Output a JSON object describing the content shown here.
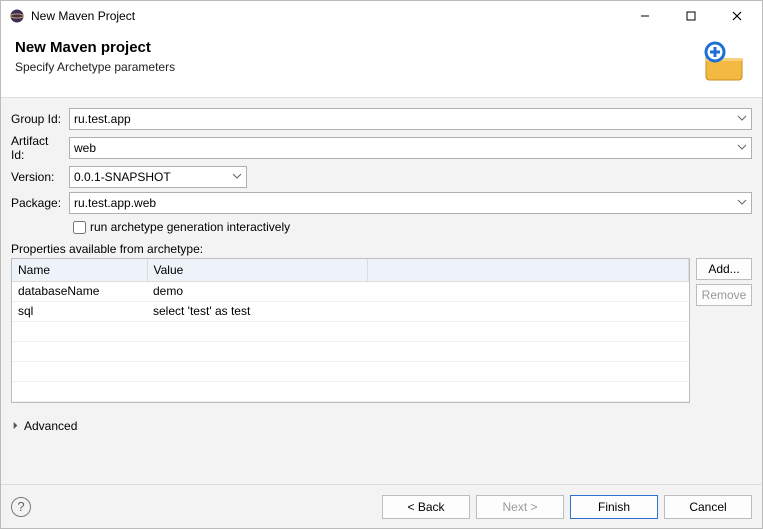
{
  "titlebar": {
    "title": "New Maven Project"
  },
  "header": {
    "heading": "New Maven project",
    "sub": "Specify Archetype parameters"
  },
  "form": {
    "groupId": {
      "label": "Group Id:",
      "value": "ru.test.app"
    },
    "artifactId": {
      "label": "Artifact Id:",
      "value": "web"
    },
    "version": {
      "label": "Version:",
      "value": "0.0.1-SNAPSHOT"
    },
    "package": {
      "label": "Package:",
      "value": "ru.test.app.web"
    },
    "interactive": {
      "label": "run archetype generation interactively",
      "checked": false
    }
  },
  "propsSection": {
    "label": "Properties available from archetype:",
    "columns": {
      "name": "Name",
      "value": "Value"
    },
    "rows": [
      {
        "name": "databaseName",
        "value": "demo"
      },
      {
        "name": "sql",
        "value": "select 'test' as test"
      }
    ],
    "addBtn": "Add...",
    "removeBtn": "Remove"
  },
  "advanced": {
    "label": "Advanced"
  },
  "footer": {
    "back": "< Back",
    "next": "Next >",
    "finish": "Finish",
    "cancel": "Cancel"
  }
}
